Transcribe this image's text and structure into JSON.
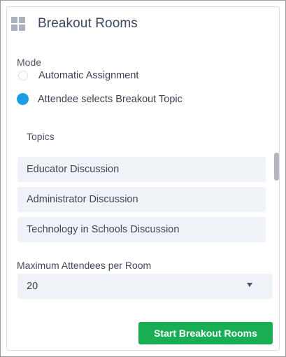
{
  "panel": {
    "title": "Breakout Rooms",
    "icon": "grid-icon"
  },
  "mode": {
    "label": "Mode",
    "options": [
      {
        "label": "Automatic Assignment",
        "selected": false
      },
      {
        "label": "Attendee selects Breakout Topic",
        "selected": true
      }
    ]
  },
  "topics": {
    "label": "Topics",
    "items": [
      "Educator Discussion",
      "Administrator Discussion",
      "Technology in Schools Discussion"
    ]
  },
  "max_attendees": {
    "label": "Maximum Attendees per Room",
    "value": "20",
    "icon": "chevron-down-icon"
  },
  "actions": {
    "start_label": "Start Breakout Rooms"
  },
  "colors": {
    "accent_blue": "#1b9ee6",
    "start_green": "#1aae54",
    "field_bg": "#eff3f7"
  }
}
